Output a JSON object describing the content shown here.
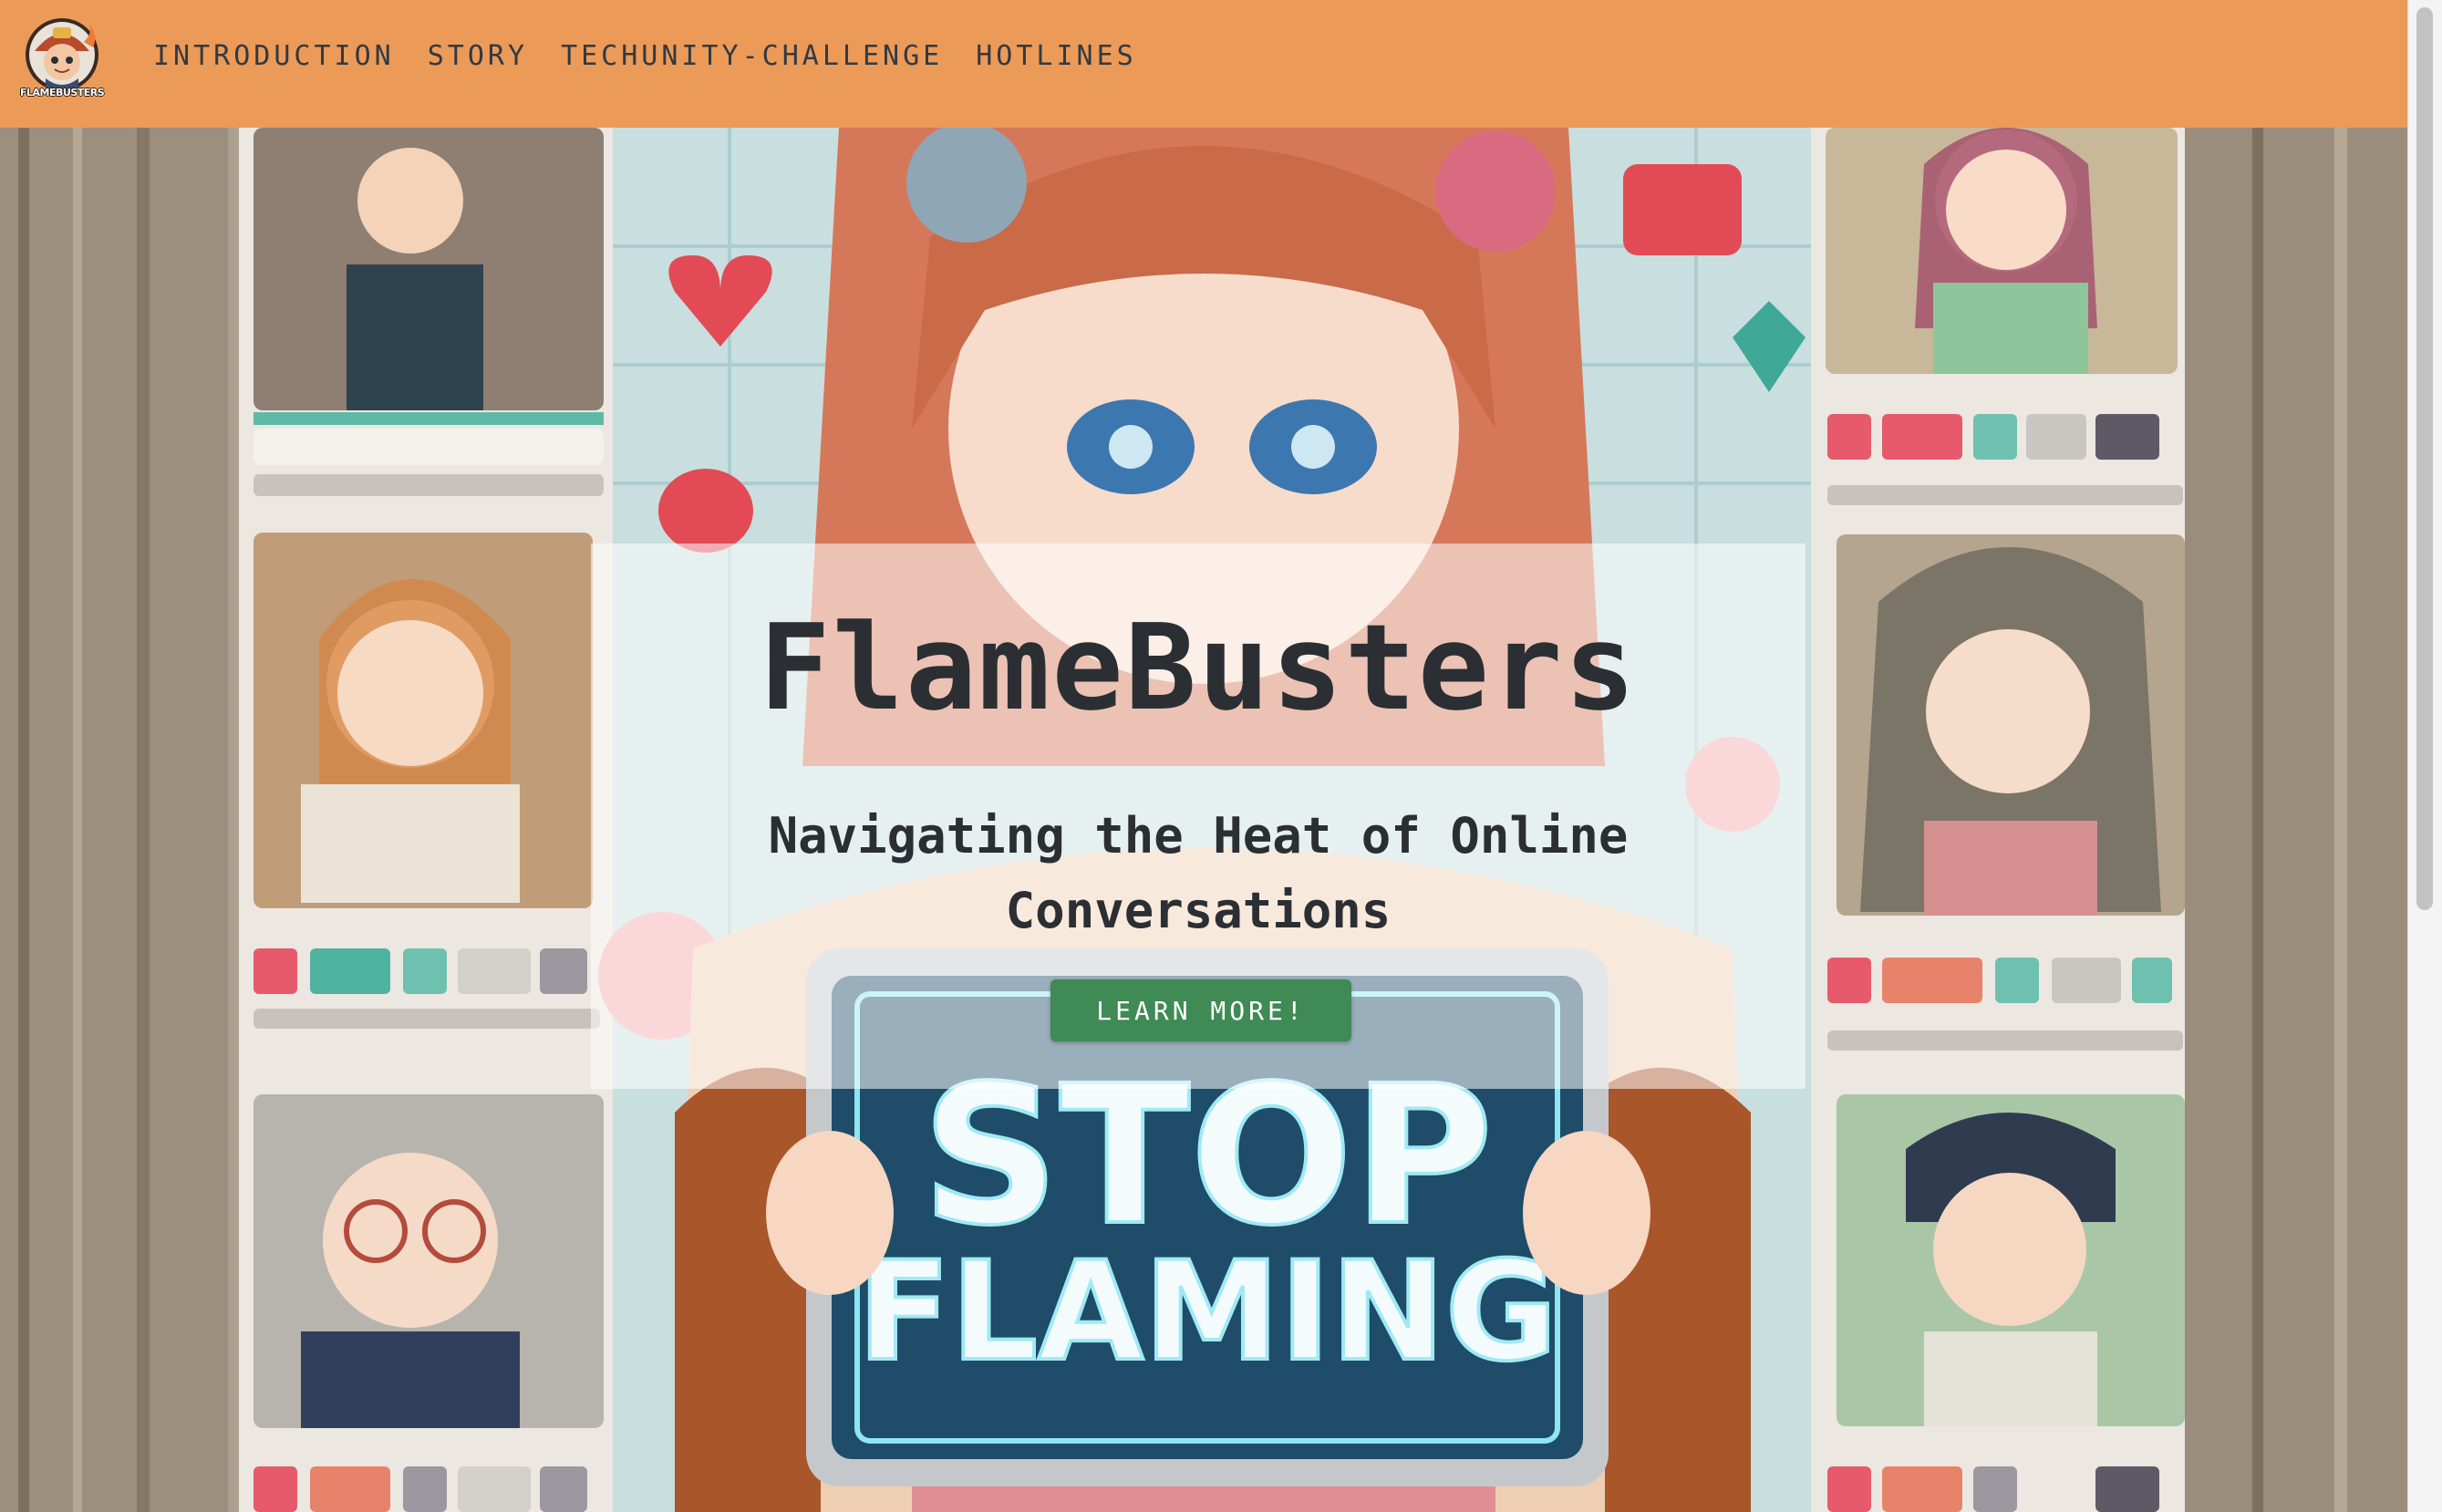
{
  "brand": {
    "logo_text": "FLAMEBUSTERS",
    "accent": "#ec9a57"
  },
  "nav": {
    "items": [
      {
        "label": "INTRODUCTION"
      },
      {
        "label": "STORY"
      },
      {
        "label": "TECHUNITY-CHALLENGE"
      },
      {
        "label": "HOTLINES"
      }
    ]
  },
  "hero": {
    "title": "FlameBusters",
    "subtitle": "Navigating the Heat of Online Conversations",
    "cta_label": "LEARN MORE!",
    "cta_color": "#3f8a55",
    "sign_line1": "STOP",
    "sign_line2": "FLAMING"
  }
}
